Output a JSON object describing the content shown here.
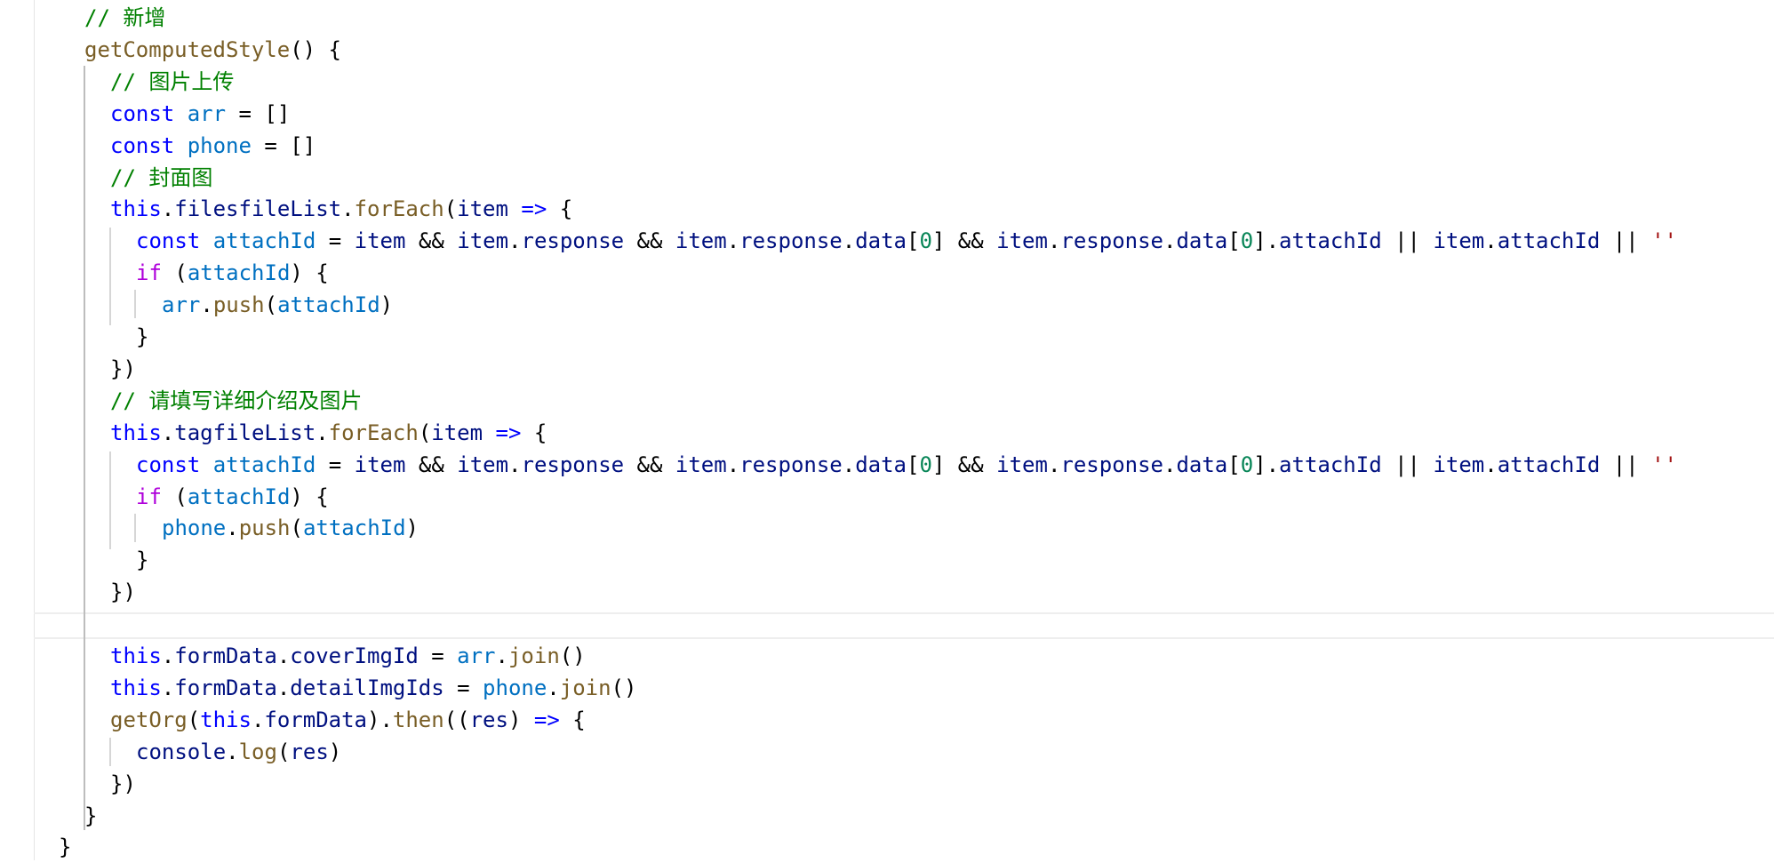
{
  "editor": {
    "colors": {
      "comment": "#008000",
      "keyword": "#0000ff",
      "control": "#af00db",
      "variable": "#0070c1",
      "property": "#001080",
      "function": "#795e26",
      "number": "#098658",
      "string": "#a31515"
    },
    "lines": [
      {
        "indent": 1,
        "tokens": [
          [
            "comment",
            "// 新增"
          ]
        ]
      },
      {
        "indent": 1,
        "tokens": [
          [
            "func",
            "getComputedStyle"
          ],
          [
            "plain",
            "() {"
          ]
        ]
      },
      {
        "indent": 2,
        "tokens": [
          [
            "comment",
            "// 图片上传"
          ]
        ]
      },
      {
        "indent": 2,
        "tokens": [
          [
            "keyword",
            "const "
          ],
          [
            "var",
            "arr"
          ],
          [
            "plain",
            " = []"
          ]
        ]
      },
      {
        "indent": 2,
        "tokens": [
          [
            "keyword",
            "const "
          ],
          [
            "var",
            "phone"
          ],
          [
            "plain",
            " = []"
          ]
        ]
      },
      {
        "indent": 2,
        "tokens": [
          [
            "comment",
            "// 封面图"
          ]
        ]
      },
      {
        "indent": 2,
        "tokens": [
          [
            "keyword",
            "this"
          ],
          [
            "plain",
            "."
          ],
          [
            "prop",
            "filesfileList"
          ],
          [
            "plain",
            "."
          ],
          [
            "func",
            "forEach"
          ],
          [
            "plain",
            "("
          ],
          [
            "prop",
            "item"
          ],
          [
            "keyword",
            " =>"
          ],
          [
            "plain",
            " {"
          ]
        ]
      },
      {
        "indent": 3,
        "tokens": [
          [
            "keyword",
            "const "
          ],
          [
            "var",
            "attachId"
          ],
          [
            "plain",
            " = "
          ],
          [
            "prop",
            "item"
          ],
          [
            "plain",
            " && "
          ],
          [
            "prop",
            "item"
          ],
          [
            "plain",
            "."
          ],
          [
            "prop",
            "response"
          ],
          [
            "plain",
            " && "
          ],
          [
            "prop",
            "item"
          ],
          [
            "plain",
            "."
          ],
          [
            "prop",
            "response"
          ],
          [
            "plain",
            "."
          ],
          [
            "prop",
            "data"
          ],
          [
            "plain",
            "["
          ],
          [
            "num",
            "0"
          ],
          [
            "plain",
            "] && "
          ],
          [
            "prop",
            "item"
          ],
          [
            "plain",
            "."
          ],
          [
            "prop",
            "response"
          ],
          [
            "plain",
            "."
          ],
          [
            "prop",
            "data"
          ],
          [
            "plain",
            "["
          ],
          [
            "num",
            "0"
          ],
          [
            "plain",
            "]."
          ],
          [
            "prop",
            "attachId"
          ],
          [
            "plain",
            " || "
          ],
          [
            "prop",
            "item"
          ],
          [
            "plain",
            "."
          ],
          [
            "prop",
            "attachId"
          ],
          [
            "plain",
            " || "
          ],
          [
            "str",
            "''"
          ]
        ]
      },
      {
        "indent": 3,
        "tokens": [
          [
            "control",
            "if"
          ],
          [
            "plain",
            " ("
          ],
          [
            "var",
            "attachId"
          ],
          [
            "plain",
            ") {"
          ]
        ]
      },
      {
        "indent": 4,
        "tokens": [
          [
            "var",
            "arr"
          ],
          [
            "plain",
            "."
          ],
          [
            "func",
            "push"
          ],
          [
            "plain",
            "("
          ],
          [
            "var",
            "attachId"
          ],
          [
            "plain",
            ")"
          ]
        ]
      },
      {
        "indent": 3,
        "tokens": [
          [
            "plain",
            "}"
          ]
        ]
      },
      {
        "indent": 2,
        "tokens": [
          [
            "plain",
            "})"
          ]
        ]
      },
      {
        "indent": 2,
        "tokens": [
          [
            "comment",
            "// 请填写详细介绍及图片"
          ]
        ]
      },
      {
        "indent": 2,
        "tokens": [
          [
            "keyword",
            "this"
          ],
          [
            "plain",
            "."
          ],
          [
            "prop",
            "tagfileList"
          ],
          [
            "plain",
            "."
          ],
          [
            "func",
            "forEach"
          ],
          [
            "plain",
            "("
          ],
          [
            "prop",
            "item"
          ],
          [
            "keyword",
            " =>"
          ],
          [
            "plain",
            " {"
          ]
        ]
      },
      {
        "indent": 3,
        "tokens": [
          [
            "keyword",
            "const "
          ],
          [
            "var",
            "attachId"
          ],
          [
            "plain",
            " = "
          ],
          [
            "prop",
            "item"
          ],
          [
            "plain",
            " && "
          ],
          [
            "prop",
            "item"
          ],
          [
            "plain",
            "."
          ],
          [
            "prop",
            "response"
          ],
          [
            "plain",
            " && "
          ],
          [
            "prop",
            "item"
          ],
          [
            "plain",
            "."
          ],
          [
            "prop",
            "response"
          ],
          [
            "plain",
            "."
          ],
          [
            "prop",
            "data"
          ],
          [
            "plain",
            "["
          ],
          [
            "num",
            "0"
          ],
          [
            "plain",
            "] && "
          ],
          [
            "prop",
            "item"
          ],
          [
            "plain",
            "."
          ],
          [
            "prop",
            "response"
          ],
          [
            "plain",
            "."
          ],
          [
            "prop",
            "data"
          ],
          [
            "plain",
            "["
          ],
          [
            "num",
            "0"
          ],
          [
            "plain",
            "]."
          ],
          [
            "prop",
            "attachId"
          ],
          [
            "plain",
            " || "
          ],
          [
            "prop",
            "item"
          ],
          [
            "plain",
            "."
          ],
          [
            "prop",
            "attachId"
          ],
          [
            "plain",
            " || "
          ],
          [
            "str",
            "''"
          ]
        ]
      },
      {
        "indent": 3,
        "tokens": [
          [
            "control",
            "if"
          ],
          [
            "plain",
            " ("
          ],
          [
            "var",
            "attachId"
          ],
          [
            "plain",
            ") {"
          ]
        ]
      },
      {
        "indent": 4,
        "tokens": [
          [
            "var",
            "phone"
          ],
          [
            "plain",
            "."
          ],
          [
            "func",
            "push"
          ],
          [
            "plain",
            "("
          ],
          [
            "var",
            "attachId"
          ],
          [
            "plain",
            ")"
          ]
        ]
      },
      {
        "indent": 3,
        "tokens": [
          [
            "plain",
            "}"
          ]
        ]
      },
      {
        "indent": 2,
        "tokens": [
          [
            "plain",
            "})"
          ]
        ]
      },
      {
        "indent": 2,
        "tokens": []
      },
      {
        "indent": 2,
        "tokens": [
          [
            "keyword",
            "this"
          ],
          [
            "plain",
            "."
          ],
          [
            "prop",
            "formData"
          ],
          [
            "plain",
            "."
          ],
          [
            "prop",
            "coverImgId"
          ],
          [
            "plain",
            " = "
          ],
          [
            "var",
            "arr"
          ],
          [
            "plain",
            "."
          ],
          [
            "func",
            "join"
          ],
          [
            "plain",
            "()"
          ]
        ]
      },
      {
        "indent": 2,
        "tokens": [
          [
            "keyword",
            "this"
          ],
          [
            "plain",
            "."
          ],
          [
            "prop",
            "formData"
          ],
          [
            "plain",
            "."
          ],
          [
            "prop",
            "detailImgIds"
          ],
          [
            "plain",
            " = "
          ],
          [
            "var",
            "phone"
          ],
          [
            "plain",
            "."
          ],
          [
            "func",
            "join"
          ],
          [
            "plain",
            "()"
          ]
        ]
      },
      {
        "indent": 2,
        "tokens": [
          [
            "func",
            "getOrg"
          ],
          [
            "plain",
            "("
          ],
          [
            "keyword",
            "this"
          ],
          [
            "plain",
            "."
          ],
          [
            "prop",
            "formData"
          ],
          [
            "plain",
            ")."
          ],
          [
            "func",
            "then"
          ],
          [
            "plain",
            "(("
          ],
          [
            "prop",
            "res"
          ],
          [
            "plain",
            ") "
          ],
          [
            "keyword",
            "=>"
          ],
          [
            "plain",
            " {"
          ]
        ]
      },
      {
        "indent": 3,
        "tokens": [
          [
            "prop",
            "console"
          ],
          [
            "plain",
            "."
          ],
          [
            "func",
            "log"
          ],
          [
            "plain",
            "("
          ],
          [
            "prop",
            "res"
          ],
          [
            "plain",
            ")"
          ]
        ]
      },
      {
        "indent": 2,
        "tokens": [
          [
            "plain",
            "})"
          ]
        ]
      },
      {
        "indent": 1,
        "tokens": [
          [
            "plain",
            "}"
          ]
        ]
      },
      {
        "indent": 0,
        "tokens": [
          [
            "plain",
            "}"
          ]
        ]
      }
    ]
  }
}
